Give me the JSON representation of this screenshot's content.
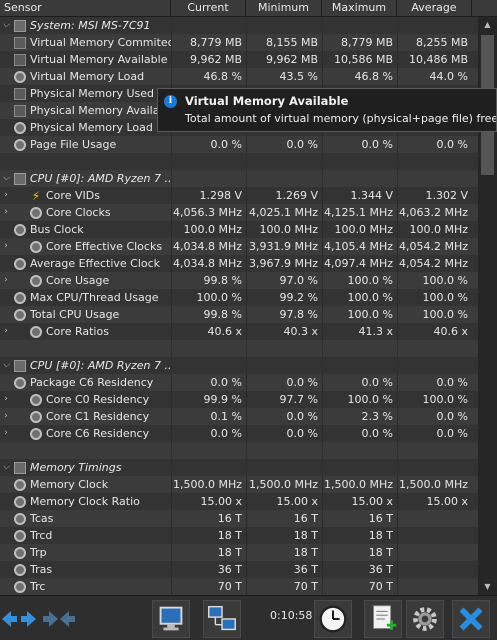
{
  "header": {
    "sensor": "Sensor",
    "current": "Current",
    "minimum": "Minimum",
    "maximum": "Maximum",
    "average": "Average"
  },
  "rows": [
    {
      "type": "group",
      "exp": "⌵",
      "label": "System: MSI MS-7C91",
      "icon": "chip-icon",
      "cur": "",
      "min": "",
      "max": "",
      "avg": ""
    },
    {
      "type": "item",
      "label": "Virtual Memory Commited",
      "icon": "square-icon",
      "cur": "8,779 MB",
      "min": "8,155 MB",
      "max": "8,779 MB",
      "avg": "8,255 MB"
    },
    {
      "type": "item",
      "label": "Virtual Memory Available",
      "icon": "square-icon",
      "cur": "9,962 MB",
      "min": "9,962 MB",
      "max": "10,586 MB",
      "avg": "10,486 MB"
    },
    {
      "type": "item",
      "label": "Virtual Memory Load",
      "icon": "clock-icon",
      "cur": "46.8 %",
      "min": "43.5 %",
      "max": "46.8 %",
      "avg": "44.0 %"
    },
    {
      "type": "item",
      "label": "Physical Memory Used",
      "icon": "square-icon",
      "cur": "",
      "min": "",
      "max": "",
      "avg": ""
    },
    {
      "type": "item",
      "label": "Physical Memory Available",
      "icon": "square-icon",
      "cur": "",
      "min": "",
      "max": "",
      "avg": ""
    },
    {
      "type": "item",
      "label": "Physical Memory Load",
      "icon": "clock-icon",
      "cur": "",
      "min": "",
      "max": "",
      "avg": ""
    },
    {
      "type": "item",
      "label": "Page File Usage",
      "icon": "clock-icon",
      "cur": "0.0 %",
      "min": "0.0 %",
      "max": "0.0 %",
      "avg": "0.0 %"
    },
    {
      "type": "blank",
      "label": "",
      "cur": "",
      "min": "",
      "max": "",
      "avg": ""
    },
    {
      "type": "group",
      "exp": "⌵",
      "label": "CPU [#0]: AMD Ryzen 7 ...",
      "icon": "chip-icon",
      "cur": "",
      "min": "",
      "max": "",
      "avg": ""
    },
    {
      "type": "sub",
      "exp": "›",
      "label": "Core VIDs",
      "icon": "bolt-icon",
      "cur": "1.298 V",
      "min": "1.269 V",
      "max": "1.344 V",
      "avg": "1.302 V"
    },
    {
      "type": "sub",
      "exp": "›",
      "label": "Core Clocks",
      "icon": "clock-icon",
      "cur": "4,056.3 MHz",
      "min": "4,025.1 MHz",
      "max": "4,125.1 MHz",
      "avg": "4,063.2 MHz"
    },
    {
      "type": "item",
      "label": "Bus Clock",
      "icon": "clock-icon",
      "cur": "100.0 MHz",
      "min": "100.0 MHz",
      "max": "100.0 MHz",
      "avg": "100.0 MHz"
    },
    {
      "type": "sub",
      "exp": "›",
      "label": "Core Effective Clocks",
      "icon": "clock-icon",
      "cur": "4,034.8 MHz",
      "min": "3,931.9 MHz",
      "max": "4,105.4 MHz",
      "avg": "4,054.2 MHz"
    },
    {
      "type": "item",
      "label": "Average Effective Clock",
      "icon": "clock-icon",
      "cur": "4,034.8 MHz",
      "min": "3,967.9 MHz",
      "max": "4,097.4 MHz",
      "avg": "4,054.2 MHz"
    },
    {
      "type": "sub",
      "exp": "›",
      "label": "Core Usage",
      "icon": "clock-icon",
      "cur": "99.8 %",
      "min": "97.0 %",
      "max": "100.0 %",
      "avg": "100.0 %"
    },
    {
      "type": "item",
      "label": "Max CPU/Thread Usage",
      "icon": "clock-icon",
      "cur": "100.0 %",
      "min": "99.2 %",
      "max": "100.0 %",
      "avg": "100.0 %"
    },
    {
      "type": "item",
      "label": "Total CPU Usage",
      "icon": "clock-icon",
      "cur": "99.8 %",
      "min": "97.8 %",
      "max": "100.0 %",
      "avg": "100.0 %"
    },
    {
      "type": "sub",
      "exp": "›",
      "label": "Core Ratios",
      "icon": "clock-icon",
      "cur": "40.6 x",
      "min": "40.3 x",
      "max": "41.3 x",
      "avg": "40.6 x"
    },
    {
      "type": "blank",
      "label": "",
      "cur": "",
      "min": "",
      "max": "",
      "avg": ""
    },
    {
      "type": "group",
      "exp": "⌵",
      "label": "CPU [#0]: AMD Ryzen 7 ...",
      "icon": "chip-icon",
      "cur": "",
      "min": "",
      "max": "",
      "avg": ""
    },
    {
      "type": "item",
      "label": "Package C6 Residency",
      "icon": "clock-icon",
      "cur": "0.0 %",
      "min": "0.0 %",
      "max": "0.0 %",
      "avg": "0.0 %"
    },
    {
      "type": "sub",
      "exp": "›",
      "label": "Core C0 Residency",
      "icon": "clock-icon",
      "cur": "99.9 %",
      "min": "97.7 %",
      "max": "100.0 %",
      "avg": "100.0 %"
    },
    {
      "type": "sub",
      "exp": "›",
      "label": "Core C1 Residency",
      "icon": "clock-icon",
      "cur": "0.1 %",
      "min": "0.0 %",
      "max": "2.3 %",
      "avg": "0.0 %"
    },
    {
      "type": "sub",
      "exp": "›",
      "label": "Core C6 Residency",
      "icon": "clock-icon",
      "cur": "0.0 %",
      "min": "0.0 %",
      "max": "0.0 %",
      "avg": "0.0 %"
    },
    {
      "type": "blank",
      "label": "",
      "cur": "",
      "min": "",
      "max": "",
      "avg": ""
    },
    {
      "type": "group",
      "exp": "⌵",
      "label": "Memory Timings",
      "icon": "chip-icon",
      "cur": "",
      "min": "",
      "max": "",
      "avg": ""
    },
    {
      "type": "item",
      "label": "Memory Clock",
      "icon": "clock-icon",
      "cur": "1,500.0 MHz",
      "min": "1,500.0 MHz",
      "max": "1,500.0 MHz",
      "avg": "1,500.0 MHz"
    },
    {
      "type": "item",
      "label": "Memory Clock Ratio",
      "icon": "clock-icon",
      "cur": "15.00 x",
      "min": "15.00 x",
      "max": "15.00 x",
      "avg": "15.00 x"
    },
    {
      "type": "item",
      "label": "Tcas",
      "icon": "clock-icon",
      "cur": "16 T",
      "min": "16 T",
      "max": "16 T",
      "avg": ""
    },
    {
      "type": "item",
      "label": "Trcd",
      "icon": "clock-icon",
      "cur": "18 T",
      "min": "18 T",
      "max": "18 T",
      "avg": ""
    },
    {
      "type": "item",
      "label": "Trp",
      "icon": "clock-icon",
      "cur": "18 T",
      "min": "18 T",
      "max": "18 T",
      "avg": ""
    },
    {
      "type": "item",
      "label": "Tras",
      "icon": "clock-icon",
      "cur": "36 T",
      "min": "36 T",
      "max": "36 T",
      "avg": ""
    },
    {
      "type": "item",
      "label": "Trc",
      "icon": "clock-icon",
      "cur": "70 T",
      "min": "70 T",
      "max": "70 T",
      "avg": ""
    }
  ],
  "tooltip": {
    "title": "Virtual Memory Available",
    "body": "Total amount of virtual memory (physical+page file) free in"
  },
  "footer": {
    "timer": "0:10:58"
  },
  "colors": {
    "info_blue": "#1a7bd6",
    "close_blue": "#2a8ee0",
    "accent_blue": "#3a8fd8"
  }
}
